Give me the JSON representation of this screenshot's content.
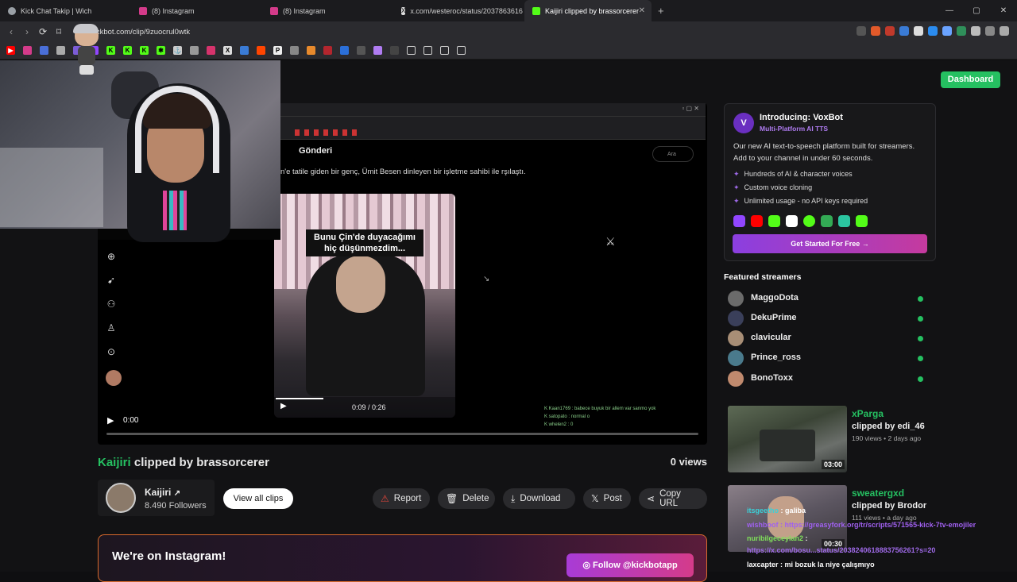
{
  "browser": {
    "tabs": [
      {
        "label": "Kick Chat Takip | Wich",
        "icon_color": "#9aa0a6"
      },
      {
        "label": "(8) Instagram",
        "icon_color": "#d43b8a"
      },
      {
        "label": "(8) Instagram",
        "icon_color": "#d43b8a"
      },
      {
        "label": "x.com/westeroc/status/2037863616",
        "icon_color": "#dddddd"
      },
      {
        "label": "Kaijiri clipped by brassorcerer",
        "icon_color": "#53fc18"
      }
    ],
    "new_tab": "+",
    "url": "kickbot.com/clip/9zuocrul0wtk",
    "nav": {
      "back": "‹",
      "forward": "›",
      "reload": "⟳",
      "bookmark": "⌑"
    },
    "window_controls": {
      "minimize": "—",
      "maximize": "▢",
      "close": "✕"
    }
  },
  "header": {
    "dashboard_label": "Dashboard"
  },
  "player": {
    "time": "0:00",
    "inner_post_title": "Gönderi",
    "inner_search": "Ara",
    "inner_post_text": "n'e tatile giden bir genç, Ümit Besen dinleyen bir işletme sahibi ile rşılaştı.",
    "tweet_video_caption": "Bunu Çin'de duyacağımı hiç düşünmezdim...",
    "tweet_video_time": "0:09 / 0:26",
    "inner_chat": [
      "K Kaan1769 : babece buyuk bir allem var sanmo yok",
      "K satopato : normal o",
      "K whelen2 : 0"
    ]
  },
  "clip": {
    "channel_link": "Kaijiri",
    "title_rest": " clipped by brassorcerer",
    "views": "0 views",
    "channel_name": "Kaijiri",
    "followers": "8.490 Followers",
    "view_all": "View all clips"
  },
  "actions": {
    "report": "Report",
    "delete": "Delete",
    "download": "Download",
    "post": "Post",
    "copy_url": "Copy URL"
  },
  "instagram": {
    "title": "We're on Instagram!",
    "follow": "Follow @kickbotapp"
  },
  "promo": {
    "title": "Introducing: VoxBot",
    "subtitle": "Multi-Platform AI TTS",
    "description": "Our new AI text-to-speech platform built for streamers. Add to your channel in under 60 seconds.",
    "features": [
      "Hundreds of AI & character voices",
      "Custom voice cloning",
      "Unlimited usage - no API keys required"
    ],
    "cta": "Get Started For Free →",
    "platform_colors": [
      "#9146ff",
      "#ff0000",
      "#53fc18",
      "#ffffff",
      "#53fc18",
      "#33aa55",
      "#2bc4a0",
      "#53fc18"
    ]
  },
  "featured": {
    "heading": "Featured streamers",
    "streamers": [
      {
        "name": "MaggoDota",
        "avatar": "#6b6b6b"
      },
      {
        "name": "DekuPrime",
        "avatar": "#3a3f5a"
      },
      {
        "name": "clavicular",
        "avatar": "#a88e76"
      },
      {
        "name": "Prince_ross",
        "avatar": "#4a7a8c"
      },
      {
        "name": "BonoToxx",
        "avatar": "#c08a6e"
      }
    ]
  },
  "recent_clips": [
    {
      "channel": "xParga",
      "by": "clipped by edi_46",
      "meta": "190 views • 2 days ago",
      "duration": "03:00"
    },
    {
      "channel": "sweatergxd",
      "by": "clipped by Brodor",
      "meta": "111 views • a day ago",
      "duration": "00:30"
    }
  ],
  "overlay_chat": [
    {
      "user": "itsgeetho",
      "msg": ": galiba",
      "color": "#3ad0d8"
    },
    {
      "user": "wishboof",
      "msg": ": https://greasyfork.org/tr/scripts/571565-kick-7tv-emojiler",
      "color": "#a060f0"
    },
    {
      "user": "nuribilgeceylan2",
      "msg": ":",
      "color": "#7fe05a"
    },
    {
      "user": "",
      "msg": "https://x.com/bosu...status/2038240618883756261?s=20",
      "color": "#9f6ae8"
    },
    {
      "user": "laxcapter",
      "msg": ": mi bozuk la niye çalışmıyo",
      "color": "#ffffff"
    }
  ]
}
